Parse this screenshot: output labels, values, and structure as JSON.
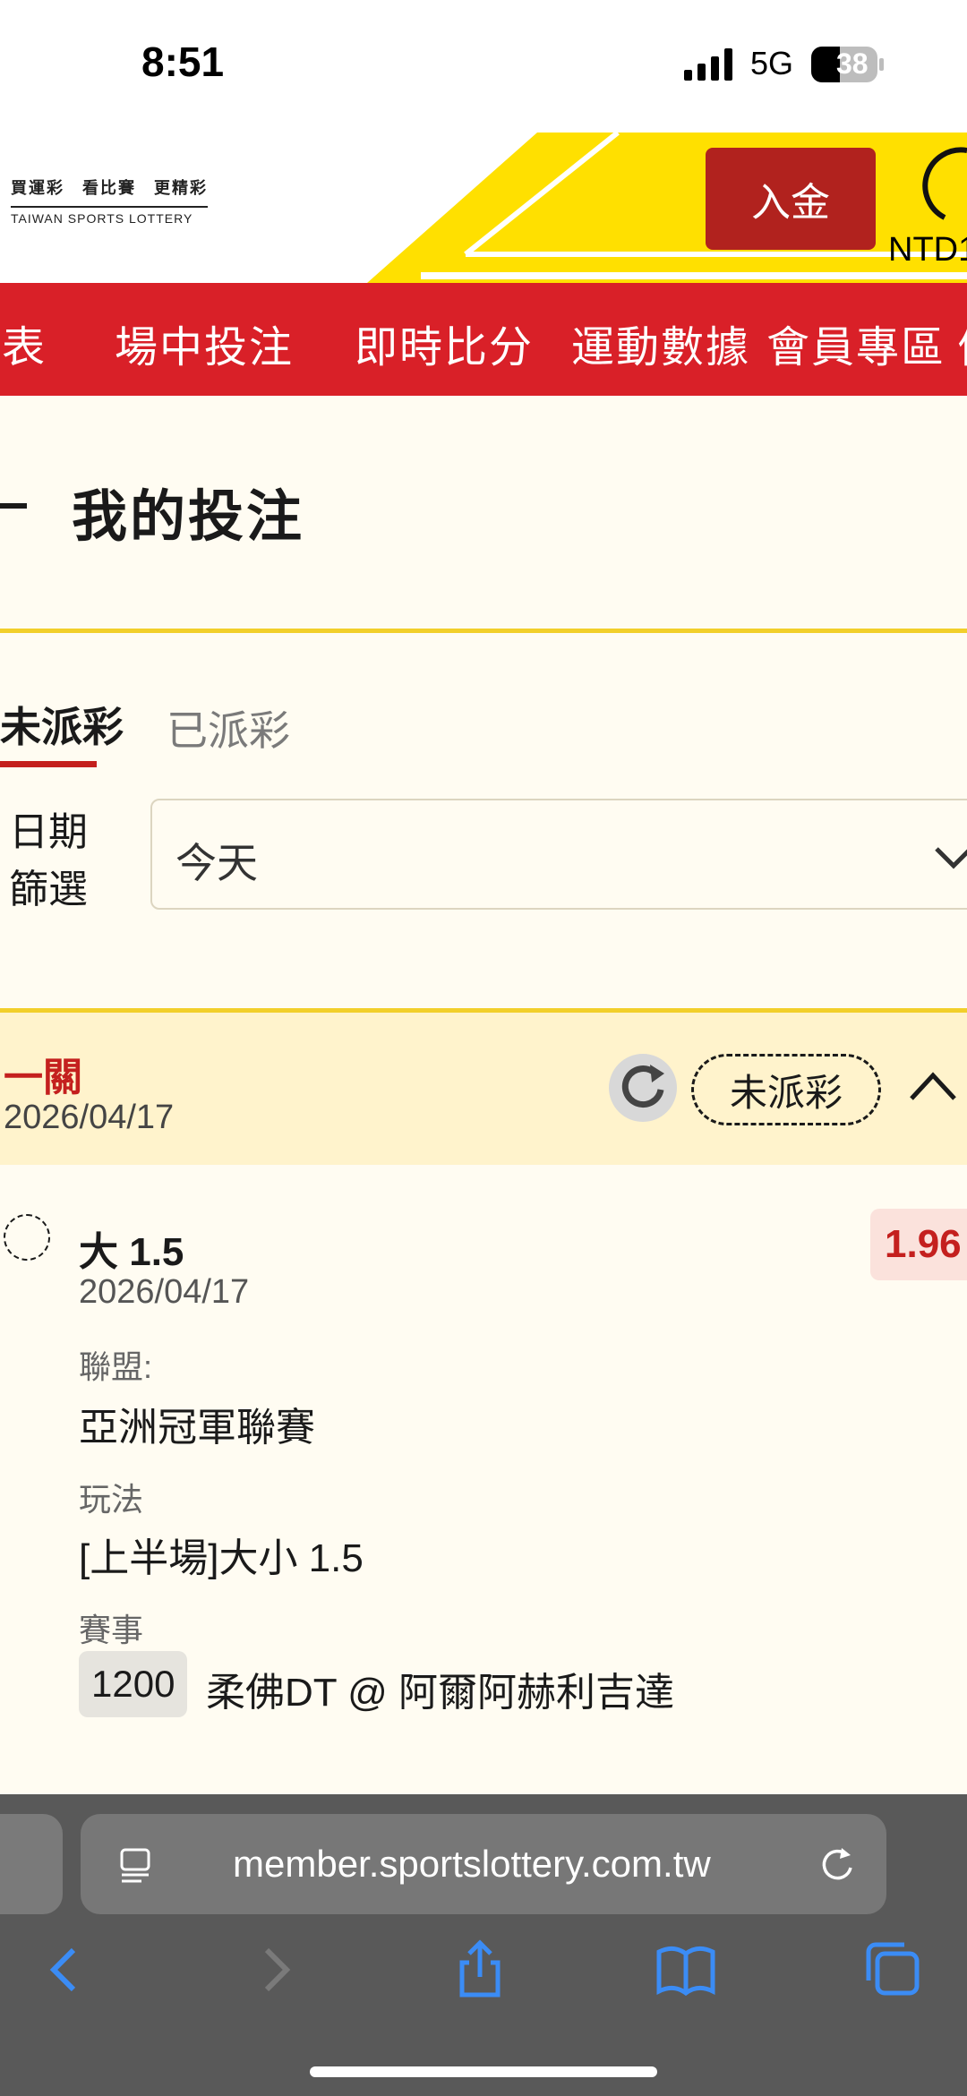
{
  "status_bar": {
    "time": "8:51",
    "network": "5G",
    "battery": "38"
  },
  "header": {
    "logo_line1": "買運彩　看比賽　更精彩",
    "logo_line2": "TAIWAN SPORTS LOTTERY",
    "deposit_label": "入金",
    "balance_text": "NTD1"
  },
  "nav": {
    "items": [
      "賽表",
      "場中投注",
      "即時比分",
      "運動數據",
      "會員專區",
      "優"
    ]
  },
  "page": {
    "title": "我的投注"
  },
  "tabs": {
    "pending": "未派彩",
    "paid": "已派彩"
  },
  "filter": {
    "label_line1": "日期",
    "label_line2": "篩選",
    "value": "今天"
  },
  "bet_card": {
    "type": "一關",
    "date": "2026/04/17",
    "status": "未派彩",
    "selection": "大 1.5",
    "odds": "1.96",
    "detail_date": "2026/04/17",
    "league_label": "聯盟:",
    "league_value": "亞洲冠軍聯賽",
    "market_label": "玩法",
    "market_value": "[上半場]大小 1.5",
    "event_label": "賽事",
    "game_id": "1200",
    "game_name": "柔佛DT @ 阿爾阿赫利吉達"
  },
  "browser": {
    "url": "member.sportslottery.com.tw"
  },
  "colors": {
    "brand_red": "#d92028",
    "accent_yellow": "#f2cf2a",
    "odds_red": "#c4201e"
  }
}
